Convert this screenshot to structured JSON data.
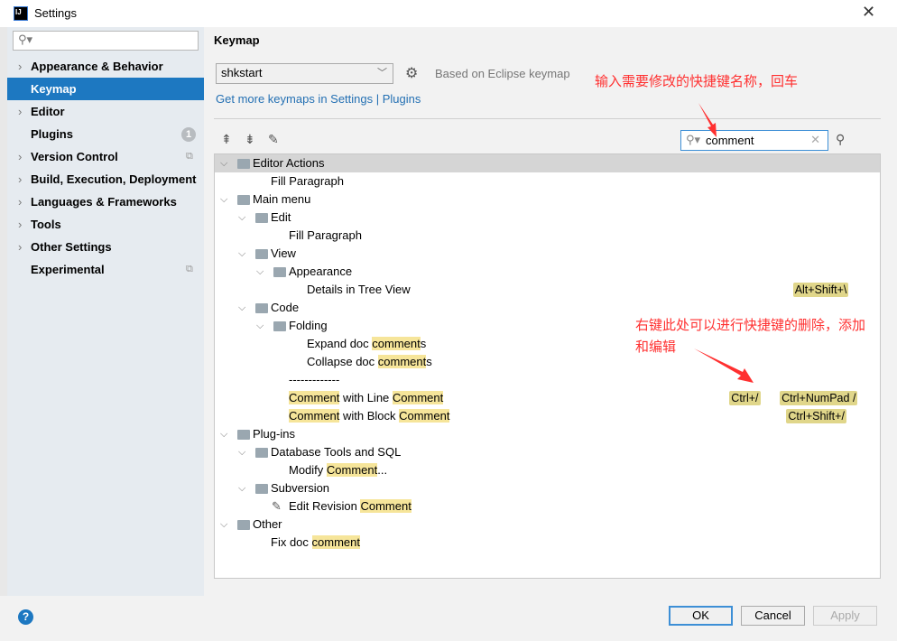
{
  "window": {
    "title": "Settings",
    "app_icon": "IJ"
  },
  "sidebar": {
    "search_placeholder": "",
    "items": [
      {
        "label": "Appearance & Behavior",
        "expandable": true
      },
      {
        "label": "Keymap",
        "selected": true
      },
      {
        "label": "Editor",
        "expandable": true
      },
      {
        "label": "Plugins",
        "badge": "1"
      },
      {
        "label": "Version Control",
        "expandable": true,
        "project_icon": true
      },
      {
        "label": "Build, Execution, Deployment",
        "expandable": true
      },
      {
        "label": "Languages & Frameworks",
        "expandable": true
      },
      {
        "label": "Tools",
        "expandable": true
      },
      {
        "label": "Other Settings",
        "expandable": true
      },
      {
        "label": "Experimental",
        "project_icon": true
      }
    ]
  },
  "main": {
    "heading": "Keymap",
    "keymap_selected": "shkstart",
    "based_on": "Based on Eclipse keymap",
    "more_link": "Get more keymaps in Settings | Plugins",
    "filter_value": "comment"
  },
  "tree": [
    {
      "level": 0,
      "exp": true,
      "icon": "folder-actions",
      "segs": [
        [
          "Editor Actions",
          0
        ]
      ],
      "selected": true
    },
    {
      "level": 1,
      "segs": [
        [
          "Fill Paragraph",
          0
        ]
      ]
    },
    {
      "level": 0,
      "exp": true,
      "icon": "folder-menu",
      "segs": [
        [
          "Main menu",
          0
        ]
      ]
    },
    {
      "level": 1,
      "exp": true,
      "icon": "folder",
      "segs": [
        [
          "Edit",
          0
        ]
      ]
    },
    {
      "level": 2,
      "segs": [
        [
          "Fill Paragraph",
          0
        ]
      ]
    },
    {
      "level": 1,
      "exp": true,
      "icon": "folder",
      "segs": [
        [
          "View",
          0
        ]
      ]
    },
    {
      "level": 2,
      "exp": true,
      "icon": "folder",
      "segs": [
        [
          "Appearance",
          0
        ]
      ]
    },
    {
      "level": 3,
      "segs": [
        [
          "Details in Tree View",
          0
        ]
      ],
      "shortcuts": [
        "Alt+Shift+\\"
      ]
    },
    {
      "level": 1,
      "exp": true,
      "icon": "folder",
      "segs": [
        [
          "Code",
          0
        ]
      ]
    },
    {
      "level": 2,
      "exp": true,
      "icon": "folder",
      "segs": [
        [
          "Folding",
          0
        ]
      ]
    },
    {
      "level": 3,
      "segs": [
        [
          "Expand doc ",
          0
        ],
        [
          "comment",
          1
        ],
        [
          "s",
          0
        ]
      ]
    },
    {
      "level": 3,
      "segs": [
        [
          "Collapse doc ",
          0
        ],
        [
          "comment",
          1
        ],
        [
          "s",
          0
        ]
      ]
    },
    {
      "level": 2,
      "segs": [
        [
          "-------------",
          0
        ]
      ]
    },
    {
      "level": 2,
      "segs": [
        [
          "Comment",
          1
        ],
        [
          " with Line ",
          0
        ],
        [
          "Comment",
          1
        ]
      ],
      "shortcuts": [
        "Ctrl+/",
        "Ctrl+NumPad /"
      ]
    },
    {
      "level": 2,
      "segs": [
        [
          "Comment",
          1
        ],
        [
          " with Block ",
          0
        ],
        [
          "Comment",
          1
        ]
      ],
      "shortcuts": [
        "Ctrl+Shift+/"
      ]
    },
    {
      "level": 0,
      "exp": true,
      "icon": "folder",
      "segs": [
        [
          "Plug-ins",
          0
        ]
      ]
    },
    {
      "level": 1,
      "exp": true,
      "icon": "folder",
      "segs": [
        [
          "Database Tools and SQL",
          0
        ]
      ]
    },
    {
      "level": 2,
      "segs": [
        [
          "Modify ",
          0
        ],
        [
          "Comment",
          1
        ],
        [
          "...",
          0
        ]
      ]
    },
    {
      "level": 1,
      "exp": true,
      "icon": "folder",
      "segs": [
        [
          "Subversion",
          0
        ]
      ]
    },
    {
      "level": 2,
      "icon": "pencil",
      "segs": [
        [
          "Edit Revision ",
          0
        ],
        [
          "Comment",
          1
        ]
      ]
    },
    {
      "level": 0,
      "exp": true,
      "icon": "folder-other",
      "segs": [
        [
          "Other",
          0
        ]
      ]
    },
    {
      "level": 1,
      "segs": [
        [
          "Fix doc ",
          0
        ],
        [
          "comment",
          1
        ]
      ]
    }
  ],
  "annotations": {
    "search_hint": "输入需要修改的快捷键名称，回车",
    "right_click_hint_1": "右键此处可以进行快捷键的删除，添加",
    "right_click_hint_2": "和编辑"
  },
  "buttons": {
    "ok": "OK",
    "cancel": "Cancel",
    "apply": "Apply",
    "help": "?"
  },
  "colors": {
    "selection": "#1d78c1",
    "highlight": "#f6e59a",
    "shortcut": "#e0d68a",
    "annotation": "#ff3030"
  }
}
